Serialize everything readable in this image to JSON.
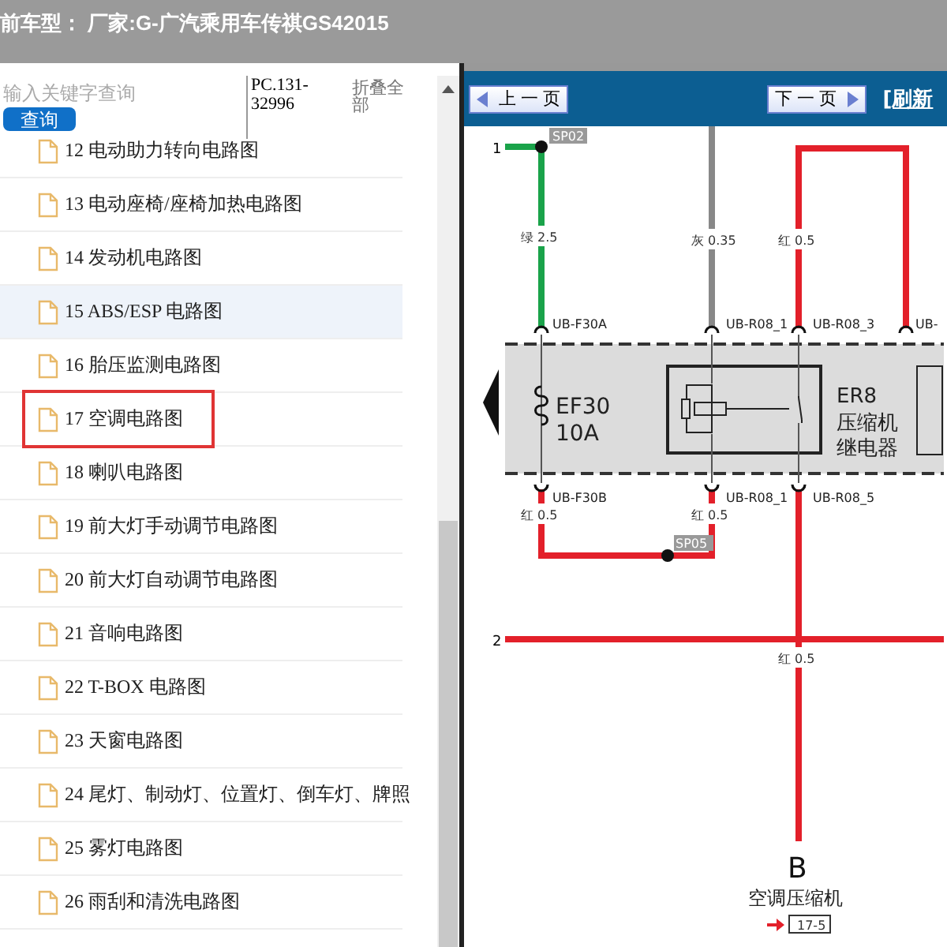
{
  "title_bar": {
    "text": "前车型： 厂家:G-广汽乘用车传祺GS42015"
  },
  "sidebar": {
    "search": {
      "placeholder": "输入关键字查询"
    },
    "search_button": "查询",
    "code": "PC.131-32996",
    "collapse_all": "折叠全部",
    "items": [
      {
        "label": "12 电动助力转向电路图",
        "selected": false,
        "highlighted": false
      },
      {
        "label": "13 电动座椅/座椅加热电路图",
        "selected": false,
        "highlighted": false
      },
      {
        "label": "14 发动机电路图",
        "selected": false,
        "highlighted": false
      },
      {
        "label": "15 ABS/ESP 电路图",
        "selected": false,
        "highlighted": true
      },
      {
        "label": "16 胎压监测电路图",
        "selected": false,
        "highlighted": false
      },
      {
        "label": "17 空调电路图",
        "selected": true,
        "highlighted": false
      },
      {
        "label": "18 喇叭电路图",
        "selected": false,
        "highlighted": false
      },
      {
        "label": "19 前大灯手动调节电路图",
        "selected": false,
        "highlighted": false
      },
      {
        "label": "20 前大灯自动调节电路图",
        "selected": false,
        "highlighted": false
      },
      {
        "label": "21 音响电路图",
        "selected": false,
        "highlighted": false
      },
      {
        "label": "22 T-BOX 电路图",
        "selected": false,
        "highlighted": false
      },
      {
        "label": "23 天窗电路图",
        "selected": false,
        "highlighted": false
      },
      {
        "label": "24 尾灯、制动灯、位置灯、倒车灯、牌照",
        "selected": false,
        "highlighted": false
      },
      {
        "label": "25 雾灯电路图",
        "selected": false,
        "highlighted": false
      },
      {
        "label": "26 雨刮和清洗电路图",
        "selected": false,
        "highlighted": false
      }
    ]
  },
  "viewer": {
    "prev_button": "上 一 页",
    "next_button": "下 一 页",
    "refresh_link": "[刷新",
    "diagram": {
      "terminals": [
        "1",
        "2"
      ],
      "splices": [
        "SP02",
        "SP05"
      ],
      "wire_labels": [
        "绿 2.5",
        "灰 0.35",
        "红 0.5",
        "红 0.5",
        "红 0.5",
        "红 0.5"
      ],
      "pins": [
        "UB-F30A",
        "UB-R08_1",
        "UB-R08_3",
        "UB-",
        "UB-F30B",
        "UB-R08_1",
        "UB-R08_5"
      ],
      "fuse": {
        "name": "EF30",
        "rating": "10A"
      },
      "relay": {
        "name": "ER8",
        "lines": [
          "压缩机",
          "继电器"
        ]
      },
      "connector": {
        "letter": "B",
        "name": "空调压缩机",
        "ref": "17-5"
      }
    }
  }
}
